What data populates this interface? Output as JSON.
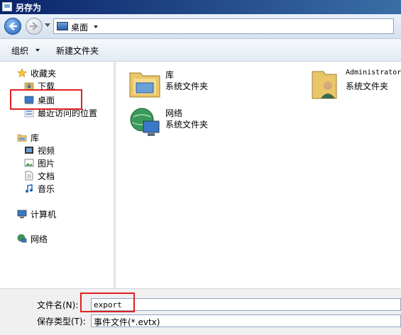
{
  "window": {
    "title": "另存为"
  },
  "address": {
    "location": "桌面"
  },
  "toolbar": {
    "organize": "组织",
    "new_folder": "新建文件夹"
  },
  "nav": {
    "favorites": {
      "label": "收藏夹",
      "items": [
        "下载",
        "桌面",
        "最近访问的位置"
      ]
    },
    "libraries": {
      "label": "库",
      "items": [
        "视频",
        "图片",
        "文档",
        "音乐"
      ]
    },
    "computer": "计算机",
    "network": "网络"
  },
  "content_items": [
    {
      "name": "库",
      "type": "系统文件夹"
    },
    {
      "name": "Administrator",
      "type": "系统文件夹"
    },
    {
      "name": "网络",
      "type": "系统文件夹"
    }
  ],
  "form": {
    "filename_label": "文件名(N):",
    "filename_value": "export",
    "filetype_label": "保存类型(T):",
    "filetype_value": "事件文件(*.evtx)"
  },
  "colors": {
    "highlight": "#e02020",
    "title_bar": "#0a246a"
  }
}
